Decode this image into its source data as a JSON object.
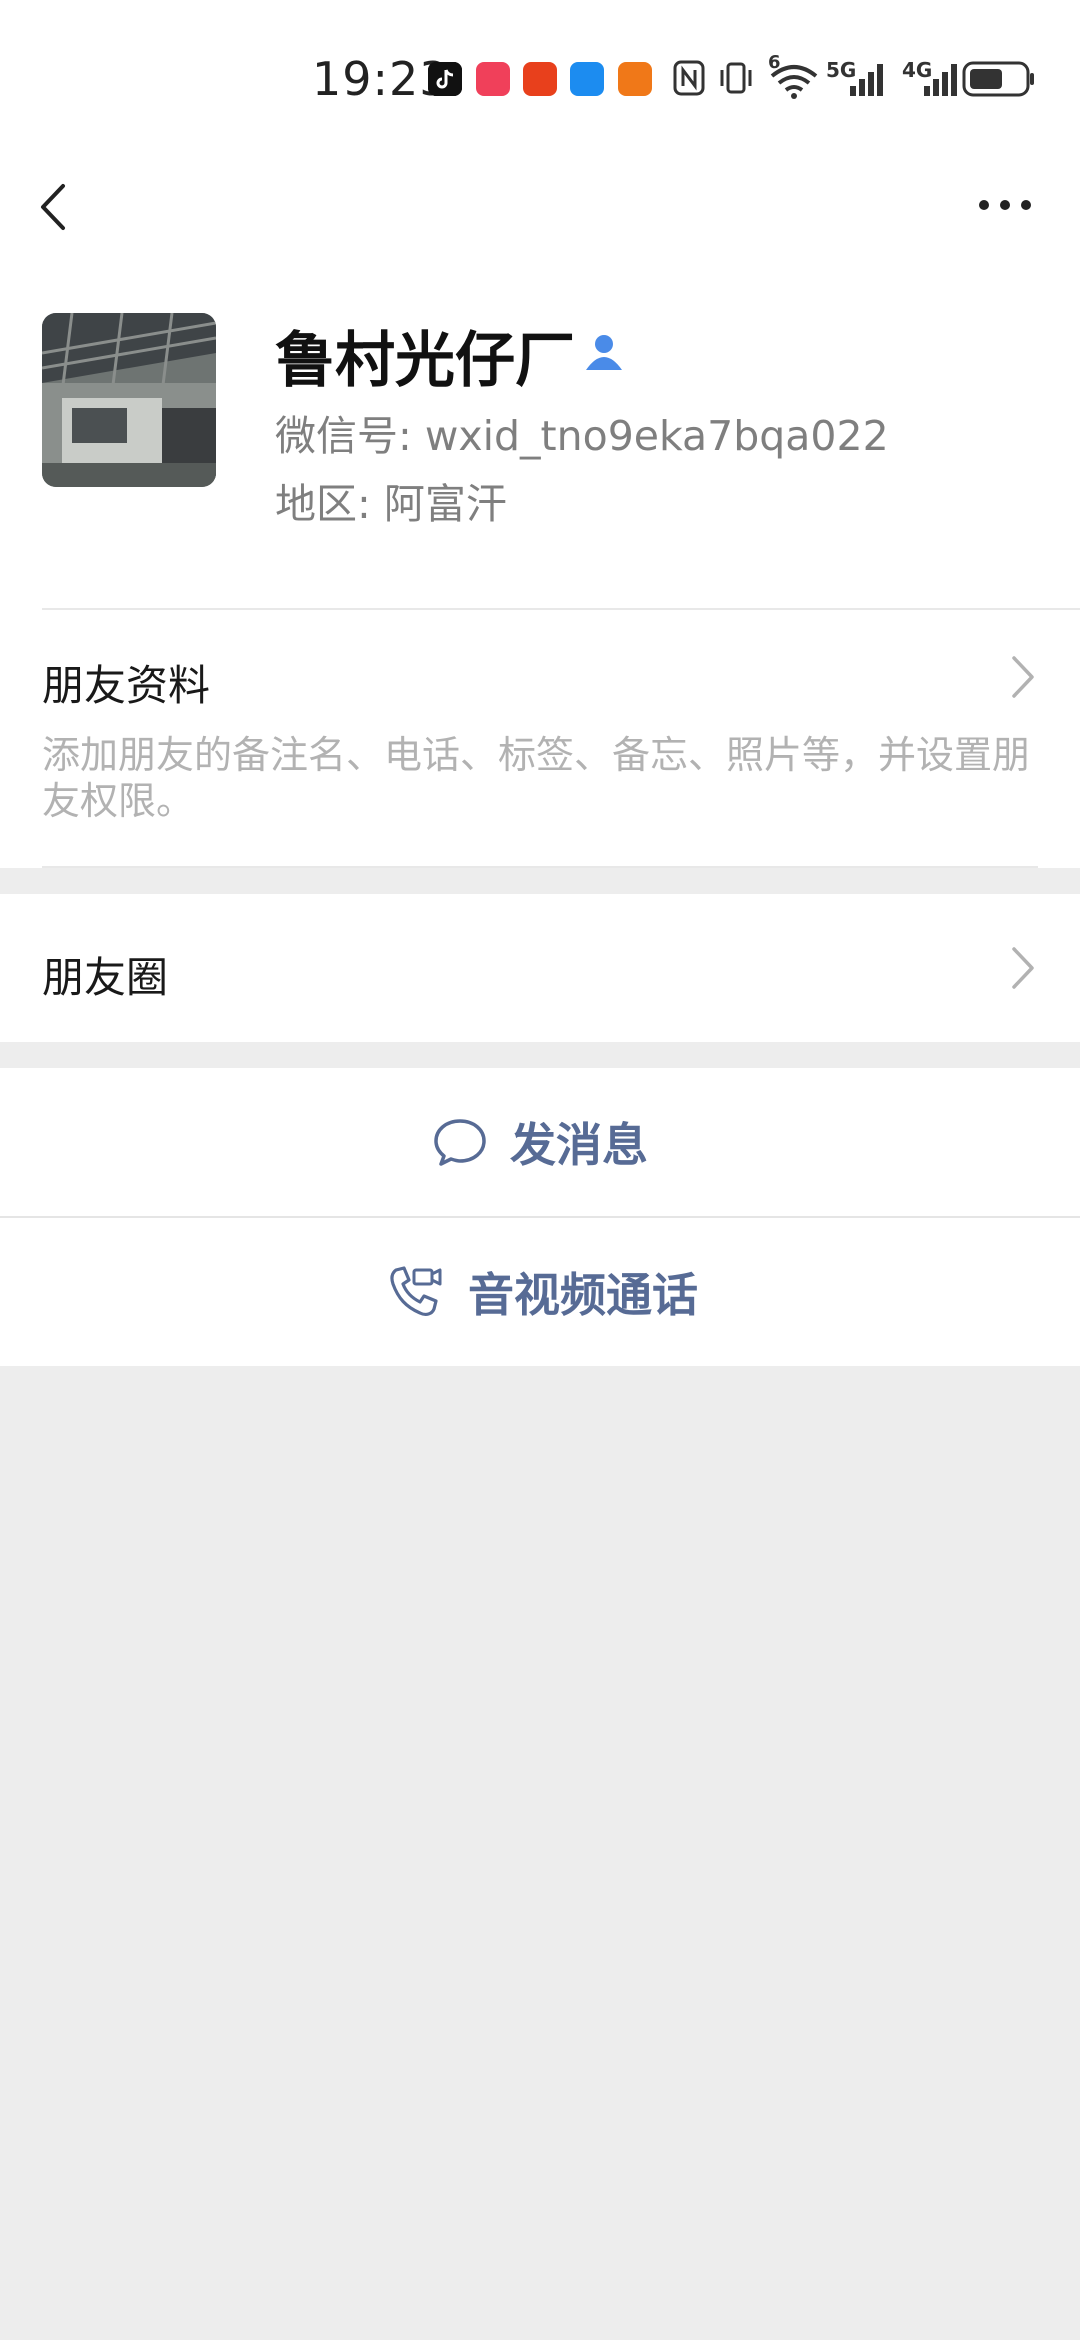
{
  "status_bar": {
    "time": "19:23",
    "network_5g": "5G",
    "network_4g": "4G",
    "wifi_badge": "6"
  },
  "profile": {
    "name": "鲁村光仔厂",
    "wechat_id": "微信号: wxid_tno9eka7bqa022",
    "region": "地区: 阿富汗"
  },
  "friend_info": {
    "title": "朋友资料",
    "description": "添加朋友的备注名、电话、标签、备忘、照片等，并设置朋友权限。"
  },
  "moments": {
    "title": "朋友圈"
  },
  "actions": {
    "send_message": "发消息",
    "av_call": "音视频通话"
  },
  "colors": {
    "link_blue": "#576b95",
    "background": "#ededed",
    "card": "#ffffff"
  }
}
